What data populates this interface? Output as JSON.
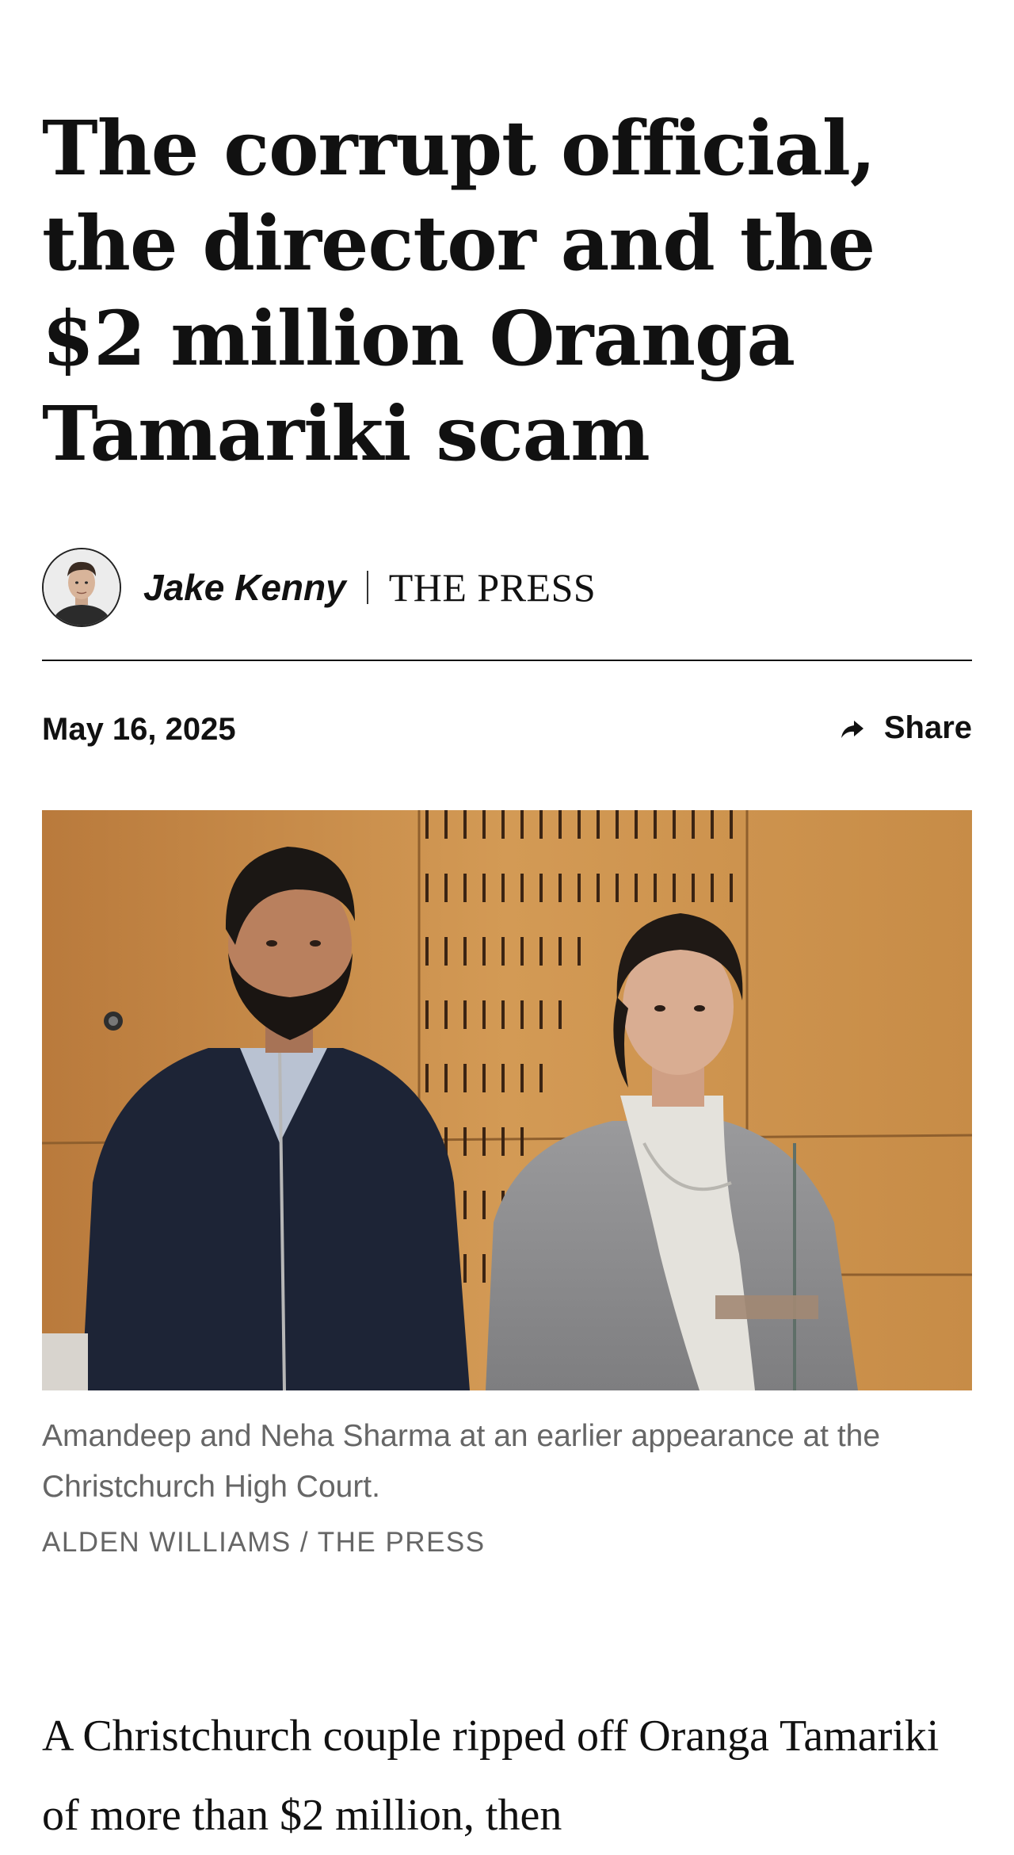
{
  "article": {
    "headline": "The corrupt official, the director and the $2 million Oranga Tamariki scam",
    "author": "Jake Kenny",
    "publisher": "THE PRESS",
    "date": "May 16, 2025",
    "share_label": "Share",
    "image": {
      "caption": "Amandeep and Neha Sharma at an earlier appearance at the Christchurch High Court.",
      "credit": "ALDEN WILLIAMS / THE PRESS"
    },
    "body_first_lines": "A Christchurch couple ripped off Oranga Tamariki of more than $2 million, then"
  },
  "icons": {
    "share": "share-arrow-icon",
    "avatar": "author-avatar"
  },
  "colors": {
    "text": "#111111",
    "caption": "#666666",
    "background": "#ffffff",
    "photo_wall": "#c8914a"
  }
}
